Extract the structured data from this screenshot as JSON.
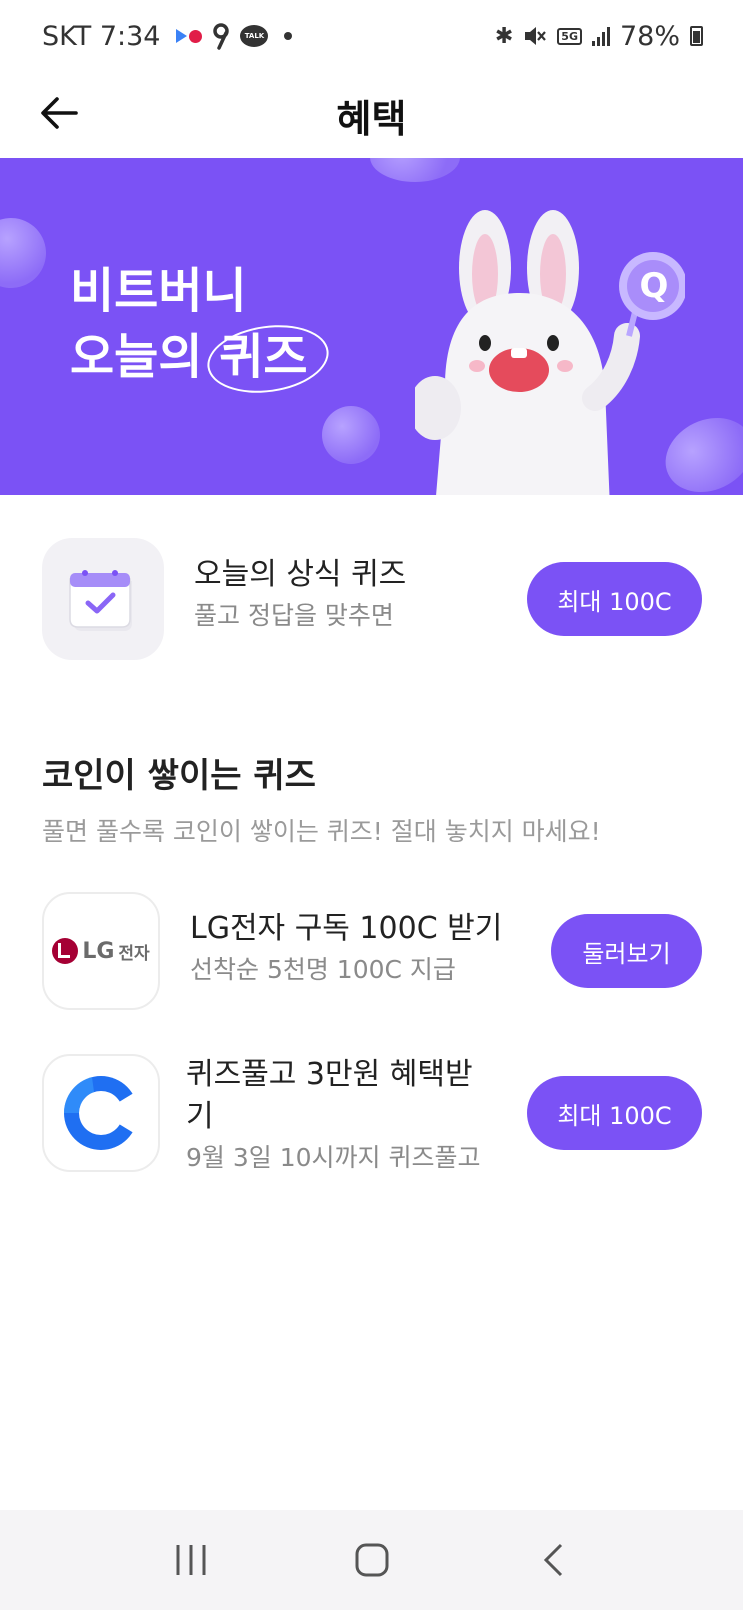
{
  "status_bar": {
    "carrier_time": "SKT 7:34",
    "talk_label": "TALK",
    "network": "5G",
    "battery": "78%"
  },
  "header": {
    "title": "혜택"
  },
  "banner": {
    "line1": "비트버니",
    "line2_prefix": "오늘의 ",
    "line2_circled": "퀴즈",
    "badge_letter": "Q",
    "colors": {
      "background": "#7b52f5"
    }
  },
  "daily_quiz": {
    "title": "오늘의 상식 퀴즈",
    "subtitle": "풀고 정답을 맞추면",
    "button": "최대 100C"
  },
  "section": {
    "title": "코인이 쌓이는 퀴즈",
    "description": "풀면 풀수록 코인이 쌓이는 퀴즈! 절대 놓치지 마세요!"
  },
  "offers": [
    {
      "brand": "LG전자",
      "brand_logo_text": "LG",
      "brand_logo_ko": "전자",
      "title": "LG전자 구독 100C 받기",
      "subtitle": "선착순 5천명 100C 지급",
      "button": "둘러보기"
    },
    {
      "brand": "coin-app",
      "title_line1": "퀴즈풀고 3만원 혜택받",
      "title_line2": "기",
      "subtitle": "9월 3일 10시까지 퀴즈풀고",
      "button": "최대 100C"
    }
  ],
  "nav": {
    "icons": [
      "recent-apps-icon",
      "home-icon",
      "back-icon"
    ]
  },
  "theme": {
    "accent": "#7b52f5",
    "text_primary": "#222222",
    "text_secondary": "#8a8a8a"
  }
}
